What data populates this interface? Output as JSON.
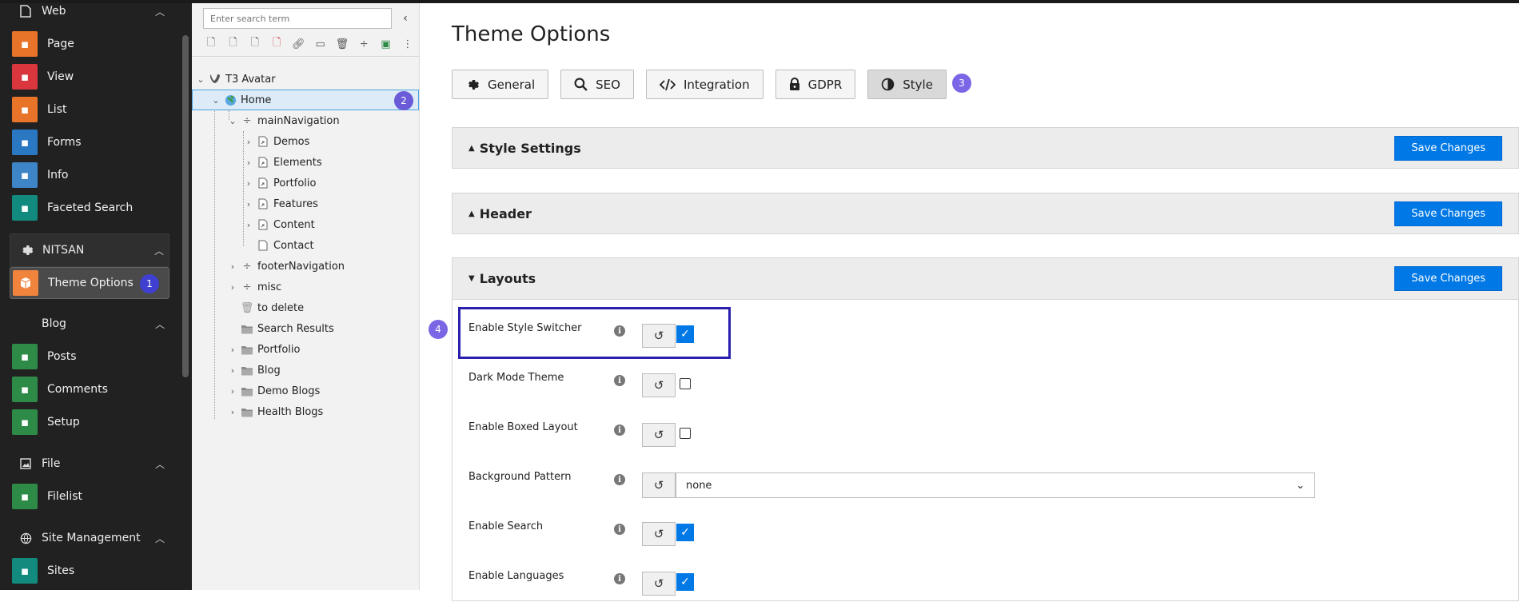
{
  "modmenu": {
    "web_label": "Web",
    "web_items": [
      {
        "label": "Page",
        "icon": "page-icon",
        "color": "#e8742a"
      },
      {
        "label": "View",
        "icon": "eye-icon",
        "color": "#d9363e"
      },
      {
        "label": "List",
        "icon": "list-icon",
        "color": "#e8742a"
      },
      {
        "label": "Forms",
        "icon": "forms-icon",
        "color": "#2b78c2"
      },
      {
        "label": "Info",
        "icon": "info-icon",
        "color": "#3d85c6"
      },
      {
        "label": "Faceted Search",
        "icon": "binoculars-icon",
        "color": "#128a7d"
      }
    ],
    "nitsan_label": "NITSAN",
    "theme_options": {
      "label": "Theme Options",
      "badge": "1",
      "color": "#f0843c"
    },
    "blog_label": "Blog",
    "blog_items": [
      {
        "label": "Posts",
        "icon": "posts-icon",
        "color": "#2e8b47"
      },
      {
        "label": "Comments",
        "icon": "comments-icon",
        "color": "#2e8b47"
      },
      {
        "label": "Setup",
        "icon": "gear-icon",
        "color": "#2e8b47"
      }
    ],
    "file_label": "File",
    "file_items": [
      {
        "label": "Filelist",
        "icon": "cloud-icon",
        "color": "#2e8b47"
      }
    ],
    "site_label": "Site Management",
    "site_items": [
      {
        "label": "Sites",
        "icon": "sites-icon",
        "color": "#128a7d"
      }
    ]
  },
  "tree": {
    "search_placeholder": "Enter search term",
    "root": "T3 Avatar",
    "home": "Home",
    "home_badge": "2",
    "main_nav": "mainNavigation",
    "main_children": [
      "Demos",
      "Elements",
      "Portfolio",
      "Features",
      "Content",
      "Contact"
    ],
    "footer_nav": "footerNavigation",
    "misc": "misc",
    "to_delete": "to delete",
    "folders": [
      "Search Results",
      "Portfolio",
      "Blog",
      "Demo Blogs",
      "Health Blogs"
    ]
  },
  "main": {
    "title": "Theme Options",
    "tabs": [
      {
        "label": "General",
        "icon": "gear-icon"
      },
      {
        "label": "SEO",
        "icon": "search-icon"
      },
      {
        "label": "Integration",
        "icon": "code-icon"
      },
      {
        "label": "GDPR",
        "icon": "lock-icon"
      },
      {
        "label": "Style",
        "icon": "contrast-icon"
      }
    ],
    "style_badge": "3",
    "panels": [
      {
        "title": "Style Settings",
        "save": "Save Changes"
      },
      {
        "title": "Header",
        "save": "Save Changes"
      },
      {
        "title": "Layouts",
        "save": "Save Changes"
      }
    ],
    "highlight_badge": "4",
    "fields": [
      {
        "label": "Enable Style Switcher",
        "type": "checkbox",
        "checked": true
      },
      {
        "label": "Dark Mode Theme",
        "type": "checkbox",
        "checked": false
      },
      {
        "label": "Enable Boxed Layout",
        "type": "checkbox",
        "checked": false
      },
      {
        "label": "Background Pattern",
        "type": "select",
        "value": "none"
      },
      {
        "label": "Enable Search",
        "type": "checkbox",
        "checked": true
      },
      {
        "label": "Enable Languages",
        "type": "checkbox",
        "checked": true
      }
    ]
  },
  "colors": {
    "primary": "#0078e6",
    "badge": "#7b66e6",
    "highlight": "#2a1fae"
  }
}
